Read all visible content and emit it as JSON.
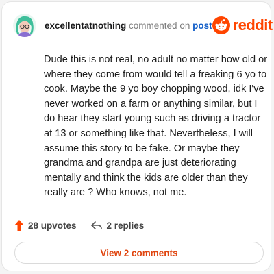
{
  "comment": {
    "username": "excellentatnothing",
    "action_text": "commented on",
    "post_link": "post",
    "body": "Dude this is not real, no adult no matter how old or where they come from would tell a freaking 6 yo to cook. Maybe the 9 yo boy chopping wood, idk I've never worked on a farm or anything similar, but I do hear they start young such as driving a tractor at 13 or something like that. Nevertheless, I will assume this story to be fake. Or maybe they grandma and grandpa are just deteriorating mentally and think the kids are older than they really are ? Who knows, not me."
  },
  "brand": {
    "wordmark": "reddit",
    "color": "#ff4500",
    "icon": "reddit-snoo-icon"
  },
  "stats": {
    "upvotes": "28 upvotes",
    "replies": "2 replies",
    "upvote_icon": "upvote-arrow-icon",
    "reply_icon": "reply-arrow-icon",
    "upvote_color": "#ff4500"
  },
  "footer": {
    "view_comments": "View 2 comments"
  },
  "avatar": {
    "icon": "user-avatar",
    "accent": "#3fbf9b"
  }
}
